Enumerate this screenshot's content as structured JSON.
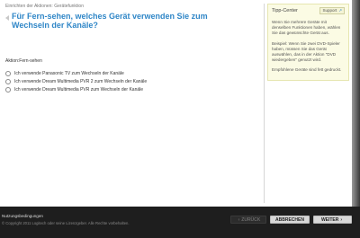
{
  "breadcrumb": "Einrichten der Aktionen: Gerätefunktion",
  "question": "Für Fern-sehen, welches Gerät verwenden Sie zum Wechseln der Kanäle?",
  "action_label": "Aktion:Fern-sehen",
  "options": [
    {
      "label": "Ich verwende Panasonic TV zum Wechseln der Kanäle",
      "selected": false
    },
    {
      "label": "Ich verwende Dream Multimedia PVR 2 zum Wechseln der Kanäle",
      "selected": false
    },
    {
      "label": "Ich verwende Dream Multimedia PVR zum Wechseln der Kanäle",
      "selected": false
    }
  ],
  "tips": {
    "title": "Tipp-Center",
    "support_label": "Support",
    "paragraphs": [
      "Wenn Sie mehrere Geräte mit denselben Funktionen haben, wählen Sie das gewünschte Gerät aus.",
      "Beispiel: Wenn Sie zwei DVD-Spieler haben, müssen Sie das Gerät auswählen, das in der Aktion \"DVD wiedergeben\" genutzt wird.",
      "Empfohlene Geräte sind fett gedruckt."
    ]
  },
  "footer": {
    "links": "Nutzungsbedingungen",
    "copyright": "© Copyright 2011 Logitech oder seine Lizenzgeber. Alle Rechte vorbehalten."
  },
  "buttons": {
    "back": "ZURÜCK",
    "cancel": "ABBRECHEN",
    "next": "WEITER"
  },
  "colors": {
    "question": "#2f86c7",
    "tips_background": "#fbfbe4",
    "footer_background": "#1e1e1e"
  }
}
